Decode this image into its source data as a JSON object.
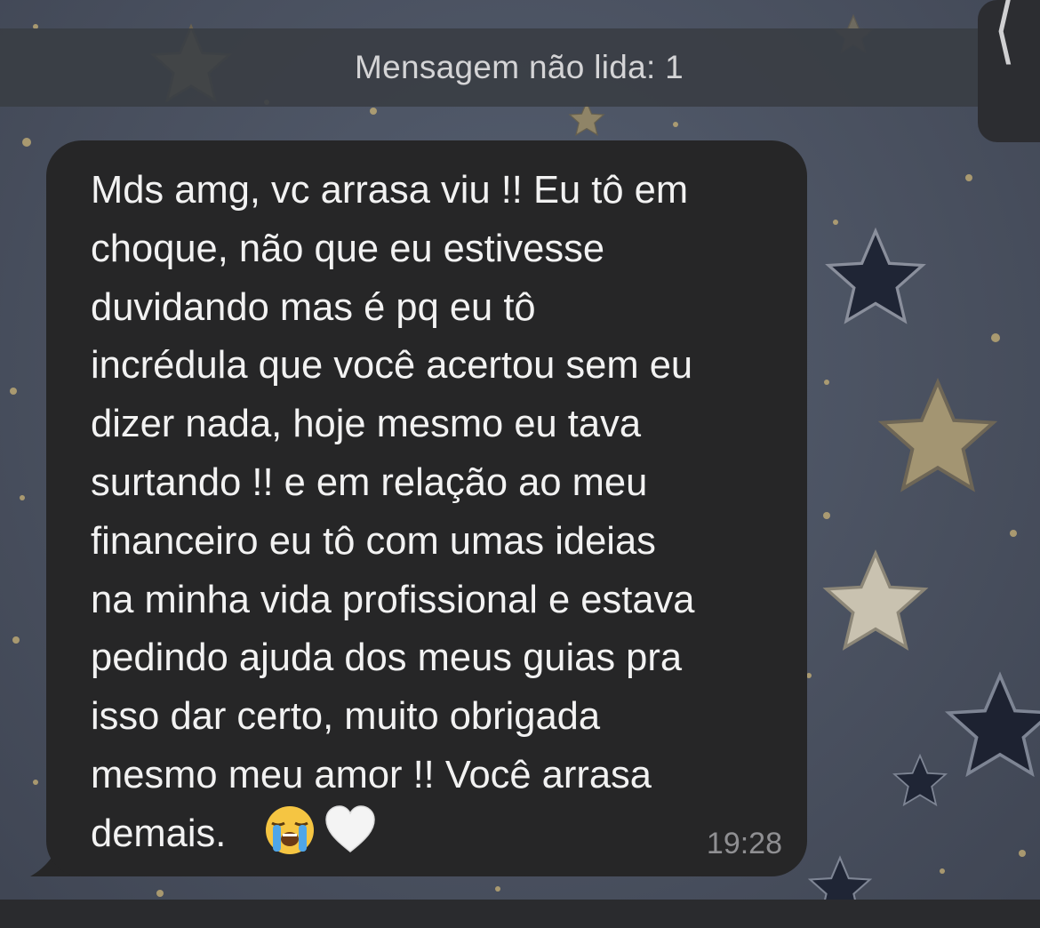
{
  "unread_banner": {
    "text": "Mensagem não lida: 1"
  },
  "side_handle": {
    "icon": "chevron-left-icon",
    "glyph": "⟨"
  },
  "message": {
    "text": "Mds amg, vc arrasa viu !! Eu tô em\nchoque, não que eu estivesse\nduvidando mas é pq eu tô\nincrédula que você acertou sem eu\ndizer nada, hoje mesmo eu tava\nsurtando !! e em relação ao meu\nfinanceiro eu tô com umas ideias\nna minha vida profissional e estava\npedindo ajuda dos meus guias pra\nisso dar certo, muito obrigada\nmesmo meu amor !! Você arrasa\ndemais.",
    "emojis": [
      "loudly-crying-face-emoji",
      "white-heart-emoji"
    ],
    "time": "19:28"
  },
  "colors": {
    "bubble": "#262627",
    "text": "#f2f2f2",
    "timestamp": "#8f8f92",
    "banner": "#3a3e44",
    "wallpaper": "#4a5160"
  }
}
